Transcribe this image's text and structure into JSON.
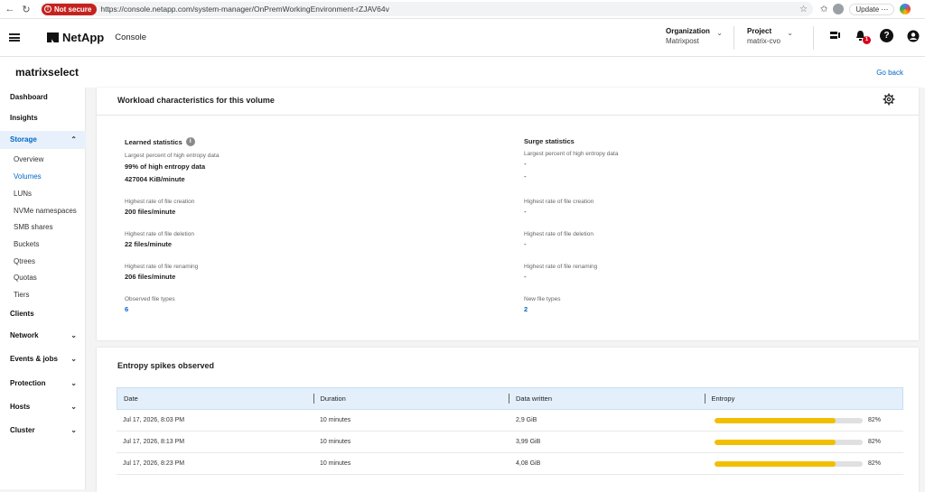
{
  "browser": {
    "security_label": "Not secure",
    "url": "https://console.netapp.com/system-manager/OnPremWorkingEnvironment-rZJAV64v",
    "update_label": "Update"
  },
  "header": {
    "brand": "NetApp",
    "app_name": "Console",
    "organization_label": "Organization",
    "organization_value": "Matrixpost",
    "project_label": "Project",
    "project_value": "matrix-cvo",
    "notification_count": "1"
  },
  "page": {
    "volume_name": "matrixselect",
    "go_back": "Go back"
  },
  "sidebar": {
    "items": [
      {
        "label": "Dashboard"
      },
      {
        "label": "Insights"
      },
      {
        "label": "Storage"
      },
      {
        "label": "Overview"
      },
      {
        "label": "Volumes"
      },
      {
        "label": "LUNs"
      },
      {
        "label": "NVMe namespaces"
      },
      {
        "label": "SMB shares"
      },
      {
        "label": "Buckets"
      },
      {
        "label": "Qtrees"
      },
      {
        "label": "Quotas"
      },
      {
        "label": "Tiers"
      },
      {
        "label": "Clients"
      },
      {
        "label": "Network"
      },
      {
        "label": "Events & jobs"
      },
      {
        "label": "Protection"
      },
      {
        "label": "Hosts"
      },
      {
        "label": "Cluster"
      }
    ]
  },
  "workload": {
    "title": "Workload characteristics for this volume",
    "learned": {
      "heading": "Learned statistics",
      "entropy_label": "Largest percent of high entropy data",
      "entropy_value": "99% of high entropy data",
      "entropy_rate": "427004 KiB/minute",
      "creation_label": "Highest rate of file creation",
      "creation_value": "200 files/minute",
      "deletion_label": "Highest rate of file deletion",
      "deletion_value": "22 files/minute",
      "renaming_label": "Highest rate of file renaming",
      "renaming_value": "206 files/minute",
      "types_label": "Observed file types",
      "types_value": "6"
    },
    "surge": {
      "heading": "Surge statistics",
      "entropy_label": "Largest percent of high entropy data",
      "entropy_value": "-",
      "entropy_rate": "-",
      "creation_label": "Highest rate of file creation",
      "creation_value": "-",
      "deletion_label": "Highest rate of file deletion",
      "deletion_value": "-",
      "renaming_label": "Highest rate of file renaming",
      "renaming_value": "-",
      "types_label": "New file types",
      "types_value": "2"
    }
  },
  "spikes": {
    "title": "Entropy spikes observed",
    "columns": [
      "Date",
      "Duration",
      "Data written",
      "Entropy"
    ],
    "rows": [
      {
        "date": "Jul 17, 2026, 8:03 PM",
        "duration": "10 minutes",
        "data_written": "2,9 GiB",
        "entropy": 82,
        "entropy_label": "82%"
      },
      {
        "date": "Jul 17, 2026, 8:13 PM",
        "duration": "10 minutes",
        "data_written": "3,99 GiB",
        "entropy": 82,
        "entropy_label": "82%"
      },
      {
        "date": "Jul 17, 2026, 8:23 PM",
        "duration": "10 minutes",
        "data_written": "4,08 GiB",
        "entropy": 82,
        "entropy_label": "82%"
      }
    ]
  },
  "colors": {
    "accent": "#0067c5",
    "entropy_bar": "#f2bf00",
    "not_secure": "#c5221f"
  }
}
